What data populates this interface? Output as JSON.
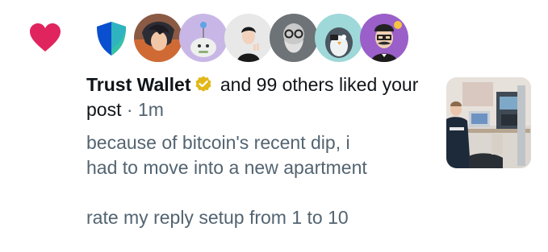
{
  "notification": {
    "type_icon": "heart-icon",
    "accent_color": "#e0245e",
    "liker_avatars": [
      "trust-wallet-shield-logo",
      "anime-character-avatar",
      "cartoon-creature-avatar",
      "man-peace-sign-avatar",
      "bearded-man-glasses-avatar",
      "penguin-avatar",
      "mustache-man-avatar"
    ],
    "user_name": "Trust Wallet",
    "verified_badge_color": "#e2b719",
    "action_text": "and 99 others liked your post",
    "separator": "·",
    "timestamp": "1m",
    "post_lines": [
      "because of bitcoin's recent dip, i",
      "had to move into a new apartment",
      "",
      "rate my reply setup from 1 to 10"
    ],
    "thumbnail": "room-setup-photo-thumbnail"
  }
}
